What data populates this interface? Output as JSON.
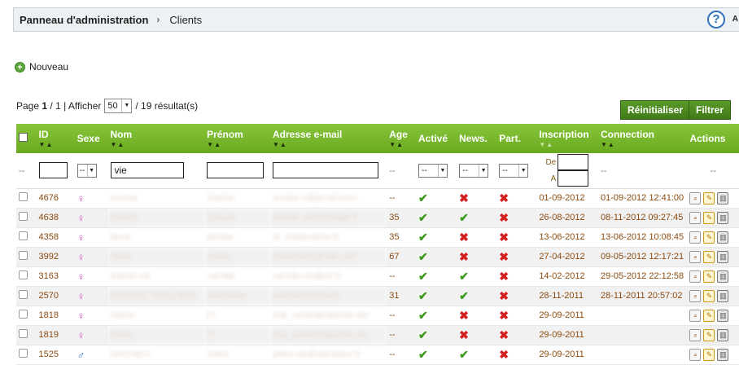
{
  "breadcrumb": {
    "home": "Panneau d'administration",
    "current": "Clients",
    "help_icon": "question-circle-icon",
    "help_label": "A"
  },
  "toolbar": {
    "new_label": "Nouveau"
  },
  "pager": {
    "page_prefix": "Page",
    "page_current": "1",
    "page_sep": "/",
    "page_total": "1",
    "show_label": "| Afficher",
    "per_page": "50",
    "results": "/ 19 résultat(s)"
  },
  "buttons": {
    "reset": "Réinitialiser",
    "filter": "Filtrer"
  },
  "columns": {
    "id": "ID",
    "sexe": "Sexe",
    "nom": "Nom",
    "prenom": "Prénom",
    "email": "Adresse e-mail",
    "age": "Age",
    "active": "Activé",
    "news": "News.",
    "part": "Part.",
    "inscription": "Inscription",
    "connection": "Connection",
    "actions": "Actions"
  },
  "filters": {
    "dash": "--",
    "sexe": "--",
    "nom_value": "vie",
    "active": "--",
    "news": "--",
    "part": "--",
    "date_from": "De",
    "date_to": "A"
  },
  "rows": [
    {
      "id": "4676",
      "sex": "female",
      "nom": "Aurelie",
      "prenom": "Sophie",
      "email": "aurelie.s@gmail.com",
      "age": "--",
      "active": true,
      "news": false,
      "part": false,
      "inscription": "01-09-2012",
      "connection": "01-09-2012 12:41:00"
    },
    {
      "id": "4638",
      "sex": "female",
      "nom": "Marion",
      "prenom": "Claude",
      "email": "amelie.vie@orange.fr",
      "age": "35",
      "active": true,
      "news": true,
      "part": false,
      "inscription": "26-08-2012",
      "connection": "08-11-2012 09:27:45"
    },
    {
      "id": "4358",
      "sex": "female",
      "nom": "laure",
      "prenom": "amelie",
      "email": "al_viel@yahoo.fr",
      "age": "35",
      "active": true,
      "news": false,
      "part": false,
      "inscription": "13-06-2012",
      "connection": "13-06-2012 10:08:45"
    },
    {
      "id": "3992",
      "sex": "female",
      "nom": "oliver",
      "prenom": "celine",
      "email": "oliviervie@gmail.com",
      "age": "67",
      "active": true,
      "news": false,
      "part": false,
      "inscription": "27-04-2012",
      "connection": "09-05-2012 12:17:21"
    },
    {
      "id": "3163",
      "sex": "female",
      "nom": "dubois vie",
      "prenom": "camille",
      "email": "camille.vie@sfr.fr",
      "age": "--",
      "active": true,
      "news": true,
      "part": false,
      "inscription": "14-02-2012",
      "connection": "29-05-2012 22:12:58"
    },
    {
      "id": "2570",
      "sex": "female",
      "nom": "RENAUD VIEILLARD",
      "prenom": "stephanie",
      "email": "svieillard@free.fr",
      "age": "31",
      "active": true,
      "news": true,
      "part": false,
      "inscription": "28-11-2011",
      "connection": "28-11-2011 20:57:02"
    },
    {
      "id": "1818",
      "sex": "female",
      "nom": "Sylvie",
      "prenom": "Fl",
      "email": "tmp_sylvie@laposte.net",
      "age": "--",
      "active": true,
      "news": false,
      "part": false,
      "inscription": "29-09-2011",
      "connection": ""
    },
    {
      "id": "1819",
      "sex": "female",
      "nom": "Pavie",
      "prenom": "Fl",
      "email": "tmp_pavie@laposte.net",
      "age": "--",
      "active": true,
      "news": false,
      "part": false,
      "inscription": "29-09-2011",
      "connection": ""
    },
    {
      "id": "1525",
      "sex": "male",
      "nom": "MATHIEU",
      "prenom": "Gilles",
      "email": "gilles.vie@wanadoo.fr",
      "age": "--",
      "active": true,
      "news": true,
      "part": false,
      "inscription": "29-09-2011",
      "connection": ""
    }
  ],
  "icons": {
    "female": "female-symbol-icon",
    "male": "male-symbol-icon",
    "yes": "check-icon",
    "no": "cross-icon",
    "view": "view-icon",
    "edit": "pencil-icon",
    "delete": "trash-icon"
  },
  "colors": {
    "header_green": "#7ab82e",
    "button_green": "#4c8a20",
    "check_green": "#3a9a1e",
    "cross_red": "#d42020",
    "id_text": "#8a4a10"
  }
}
